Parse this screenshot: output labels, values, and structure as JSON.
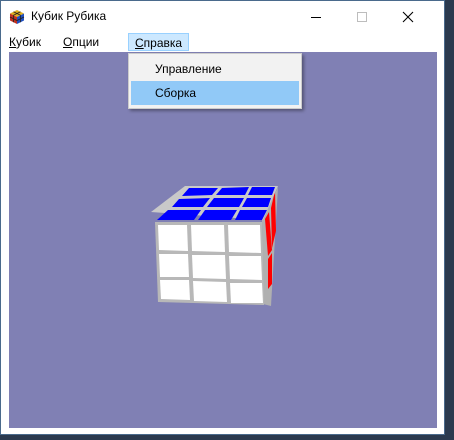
{
  "window": {
    "title": "Кубик Рубика",
    "icon": "rubiks-cube-app-icon",
    "controls": {
      "minimize": "minimize-icon",
      "maximize": "maximize-icon",
      "close": "close-icon"
    }
  },
  "menubar": {
    "items": [
      {
        "first": "К",
        "rest": "убик"
      },
      {
        "first": "О",
        "rest": "пции"
      },
      {
        "first": "С",
        "rest": "правка"
      }
    ],
    "active_index": 2
  },
  "dropdown": {
    "items": [
      "Управление",
      "Сборка"
    ],
    "highlighted_index": 1
  },
  "colors": {
    "viewport_background": "#8080b4",
    "cube_top": "#0000ff",
    "cube_front": "#ffffff",
    "cube_right": "#ff0000",
    "menu_highlight": "#91c9f7"
  }
}
